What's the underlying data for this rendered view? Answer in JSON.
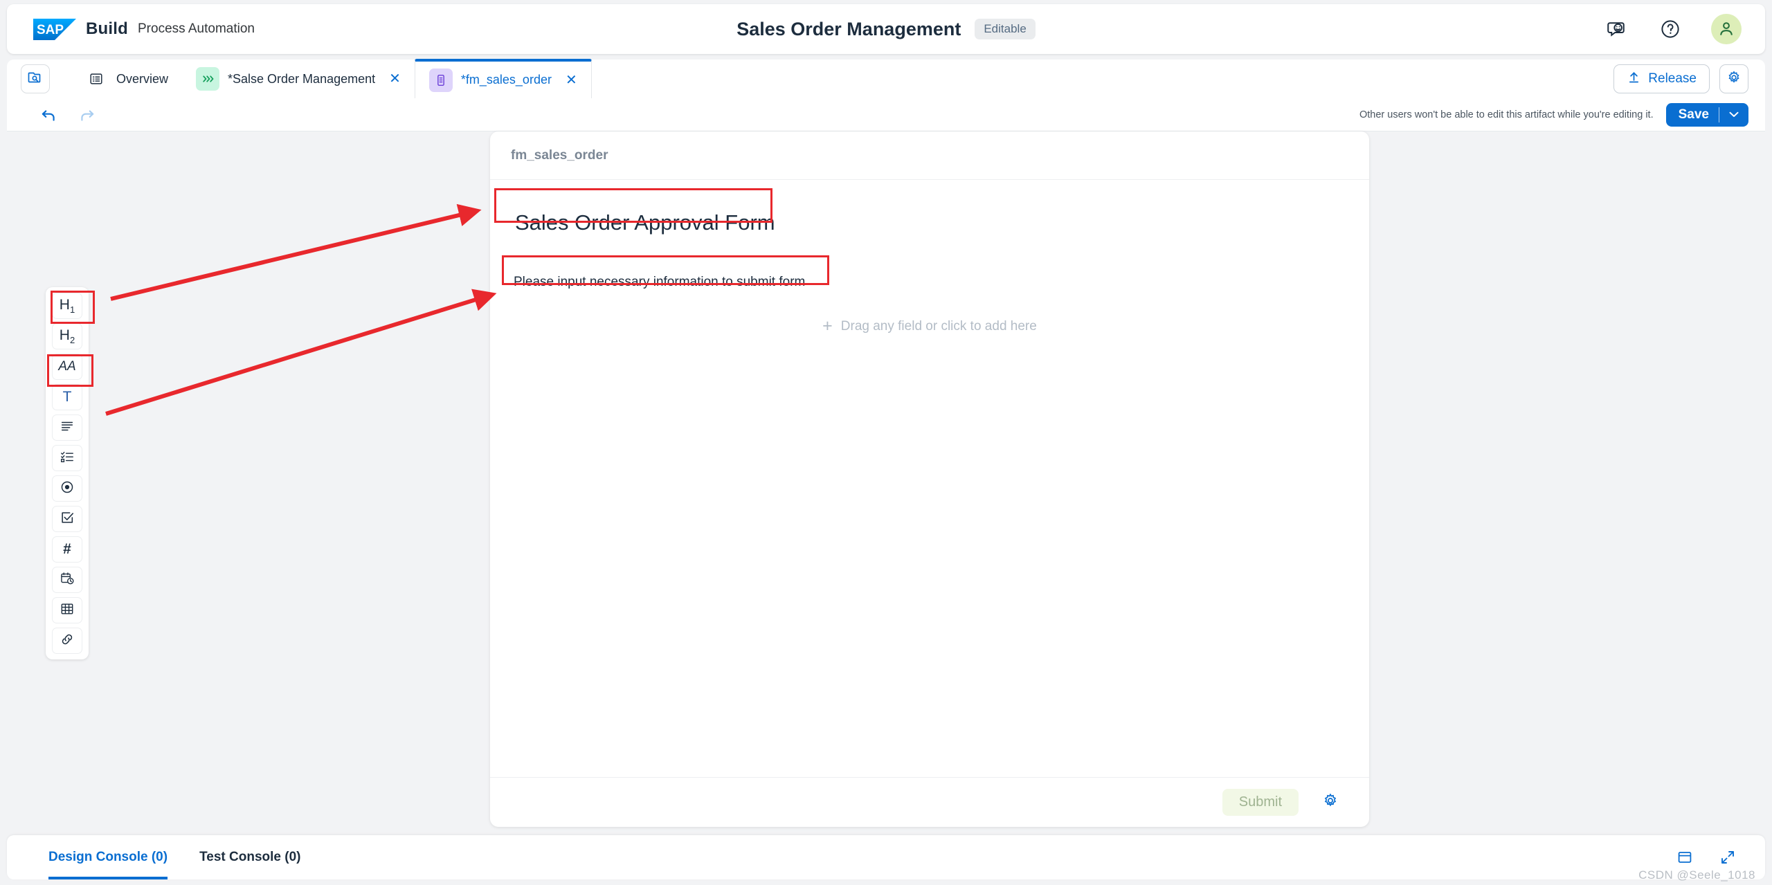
{
  "header": {
    "brand_name": "Build",
    "brand_sub": "Process Automation",
    "logo_text": "SAP",
    "title": "Sales Order Management",
    "status_badge": "Editable",
    "icons": {
      "feedback": "feedback-smiley-icon",
      "help": "help-question-icon",
      "avatar": "user-avatar-icon"
    }
  },
  "tabbar": {
    "explorer_icon": "folder-search-icon",
    "tabs": [
      {
        "label": "Overview",
        "icon": "overview-list-icon",
        "closable": false,
        "active": false
      },
      {
        "label": "*Salse Order Management",
        "icon": "process-chevrons-icon",
        "closable": true,
        "active": false,
        "close": "✕"
      },
      {
        "label": "*fm_sales_order",
        "icon": "form-icon",
        "closable": true,
        "active": true,
        "close": "✕"
      }
    ],
    "release_label": "Release",
    "release_icon": "upload-arrow-icon",
    "settings_icon": "gear-icon"
  },
  "toolbar": {
    "undo_icon": "undo-arrow-icon",
    "redo_icon": "redo-arrow-icon",
    "edit_note": "Other users won't be able to edit this artifact while you're editing it.",
    "save_label": "Save",
    "save_caret": "⌄"
  },
  "palette": {
    "items": [
      {
        "name": "heading-1",
        "glyph": "H",
        "sub": "1"
      },
      {
        "name": "heading-2",
        "glyph": "H",
        "sub": "2"
      },
      {
        "name": "paragraph-text",
        "glyph": "AA",
        "sub": ""
      },
      {
        "name": "text-input",
        "glyph": "T",
        "sub": ""
      },
      {
        "name": "text-area",
        "glyph": "",
        "sub": ""
      },
      {
        "name": "multi-select-list",
        "glyph": "",
        "sub": ""
      },
      {
        "name": "radio-button",
        "glyph": "",
        "sub": ""
      },
      {
        "name": "checkbox",
        "glyph": "",
        "sub": ""
      },
      {
        "name": "number-field",
        "glyph": "#",
        "sub": ""
      },
      {
        "name": "date-time-field",
        "glyph": "",
        "sub": ""
      },
      {
        "name": "table-field",
        "glyph": "",
        "sub": ""
      },
      {
        "name": "link-field",
        "glyph": "",
        "sub": ""
      }
    ]
  },
  "form": {
    "artifact_name": "fm_sales_order",
    "title": "Sales Order Approval Form",
    "subtitle": "Please input necessary information to submit form",
    "drop_hint": "Drag any field or click to add here",
    "drop_plus": "+",
    "submit_label": "Submit",
    "settings_icon": "gear-icon"
  },
  "console": {
    "tabs": [
      {
        "label": "Design Console (0)",
        "active": true
      },
      {
        "label": "Test Console (0)",
        "active": false
      }
    ],
    "split_icon": "split-panel-icon",
    "expand_icon": "expand-fullscreen-icon"
  },
  "watermark": "CSDN @Seele_1018",
  "colors": {
    "accent_blue": "#0a6ed1",
    "annotation_red": "#e8282d",
    "badge_grey": "#eaecee",
    "avatar_green": "#ddeeb8",
    "canvas_grey": "#f2f3f5"
  }
}
